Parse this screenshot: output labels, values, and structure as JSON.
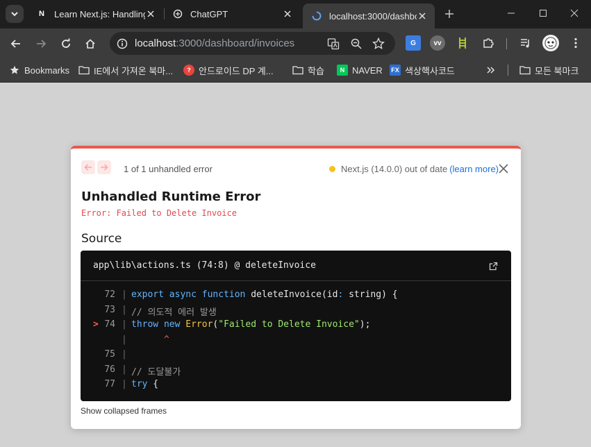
{
  "tabs": [
    {
      "title": "Learn Next.js: Handling",
      "favicon": "N",
      "active": false
    },
    {
      "title": "ChatGPT",
      "favicon": "chatgpt-icon",
      "active": false
    },
    {
      "title": "localhost:3000/dashboa",
      "favicon": "loading-icon",
      "active": true
    }
  ],
  "address": {
    "host": "localhost",
    "rest": ":3000/dashboard/invoices"
  },
  "bookmarks": [
    {
      "label": "Bookmarks",
      "icon": "star-icon"
    },
    {
      "label": "IE에서 가져온 북마...",
      "icon": "folder-icon"
    },
    {
      "label": "안드로이드 DP 계...",
      "icon": "dp-icon"
    },
    {
      "label": "학습",
      "icon": "folder-icon"
    },
    {
      "label": "NAVER",
      "icon": "naver-icon",
      "badge": "N"
    },
    {
      "label": "색상핵사코드",
      "icon": "fx-icon",
      "badge": "FX"
    },
    {
      "label": "모든 북마크",
      "icon": "folder-icon"
    }
  ],
  "overlay": {
    "error_count": "1 of 1 unhandled error",
    "version_text": "Next.js (14.0.0) out of date",
    "learn_more": "(learn more)",
    "title": "Unhandled Runtime Error",
    "message": "Error: Failed to Delete Invoice",
    "source_label": "Source",
    "file": "app\\lib\\actions.ts (74:8) @ deleteInvoice",
    "collapsed_frames": "Show collapsed frames"
  },
  "code_lines": [
    {
      "ln": "72",
      "marker": "",
      "parts": [
        [
          "kw",
          "export"
        ],
        [
          "fn",
          " "
        ],
        [
          "kw",
          "async"
        ],
        [
          "fn",
          " "
        ],
        [
          "kw",
          "function"
        ],
        [
          "fn",
          " deleteInvoice(id"
        ],
        [
          "kw",
          ":"
        ],
        [
          "fn",
          " string) {"
        ]
      ]
    },
    {
      "ln": "73",
      "marker": "",
      "parts": [
        [
          "cm",
          "// 의도적 에러 발생"
        ]
      ]
    },
    {
      "ln": "74",
      "marker": ">",
      "parts": [
        [
          "kw",
          "throw"
        ],
        [
          "fn",
          " "
        ],
        [
          "kw",
          "new"
        ],
        [
          "fn",
          " "
        ],
        [
          "cls",
          "Error"
        ],
        [
          "fn",
          "("
        ],
        [
          "str",
          "\"Failed to Delete Invoice\""
        ],
        [
          "fn",
          ");"
        ]
      ]
    },
    {
      "ln": "",
      "marker": "",
      "parts": [
        [
          "caret",
          "      ^"
        ]
      ]
    },
    {
      "ln": "75",
      "marker": "",
      "parts": []
    },
    {
      "ln": "76",
      "marker": "",
      "parts": [
        [
          "cm",
          "// 도달불가"
        ]
      ]
    },
    {
      "ln": "77",
      "marker": "",
      "parts": [
        [
          "kw",
          "try"
        ],
        [
          "fn",
          " {"
        ]
      ]
    }
  ]
}
